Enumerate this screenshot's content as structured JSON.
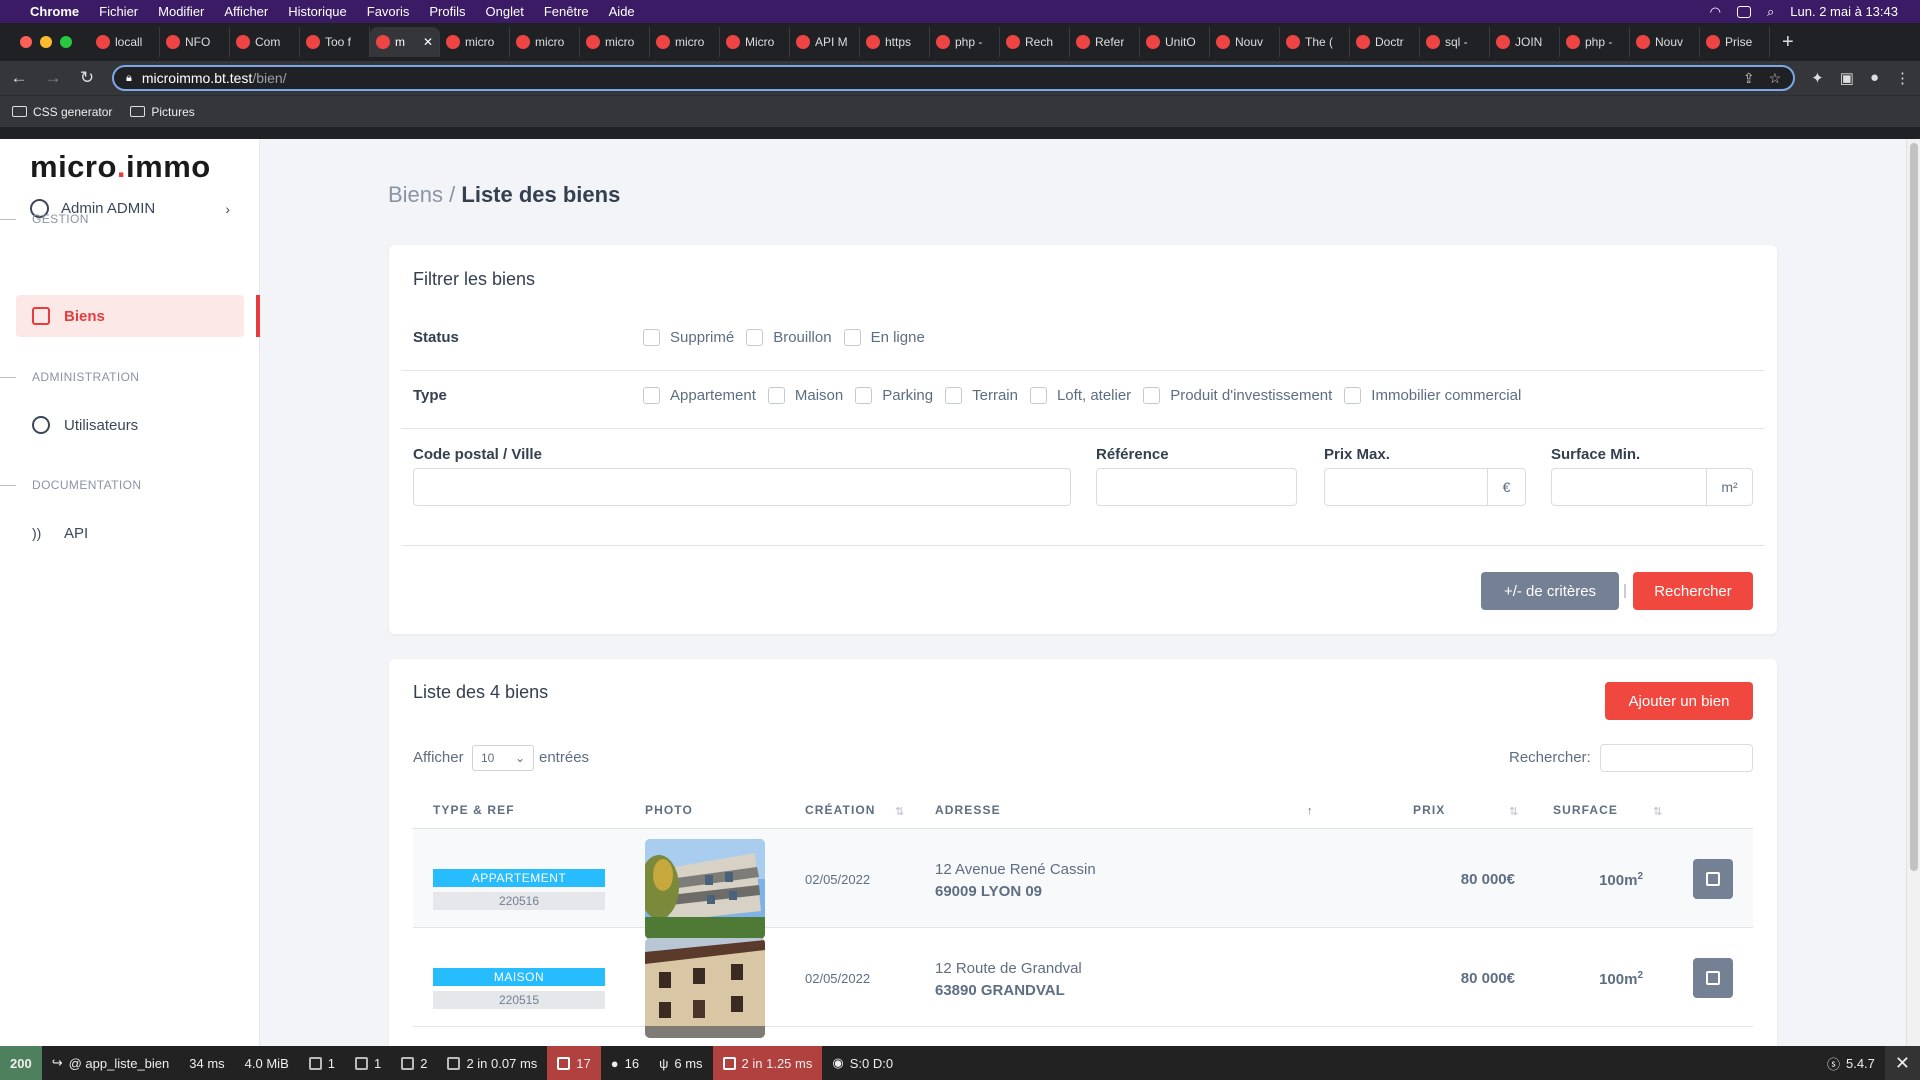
{
  "mac_menu": {
    "app": "Chrome",
    "items": [
      "Fichier",
      "Modifier",
      "Afficher",
      "Historique",
      "Favoris",
      "Profils",
      "Onglet",
      "Fenêtre",
      "Aide"
    ],
    "clock": "Lun. 2 mai à  13:43"
  },
  "tabs": [
    "locall",
    "NFO",
    "Com",
    "Too f",
    "m",
    "micro",
    "micro",
    "micro",
    "micro",
    "Micro",
    "API M",
    "https",
    "php -",
    "Rech",
    "Refer",
    "UnitO",
    "Nouv",
    "The (",
    "Doctr",
    "sql -",
    "JOIN",
    "php -",
    "Nouv",
    "Prise"
  ],
  "active_tab_index": 4,
  "url": {
    "host": "microimmo.bt.test",
    "path": "/bien/"
  },
  "bookmarks": [
    "CSS generator",
    "Pictures"
  ],
  "sidebar": {
    "logo_a": "micro",
    "logo_dot": ".",
    "logo_b": "immo",
    "user": "Admin ADMIN",
    "sections": [
      "GESTION",
      "ADMINISTRATION",
      "DOCUMENTATION"
    ],
    "items": [
      "Biens",
      "Utilisateurs",
      "API"
    ]
  },
  "breadcrumb": {
    "parent": "Biens",
    "separator": " / ",
    "current": "Liste des biens"
  },
  "filter": {
    "title": "Filtrer les biens",
    "status_label": "Status",
    "status_options": [
      "Supprimé",
      "Brouillon",
      "En ligne"
    ],
    "type_label": "Type",
    "type_options": [
      "Appartement",
      "Maison",
      "Parking",
      "Terrain",
      "Loft, atelier",
      "Produit d'investissement",
      "Immobilier commercial"
    ],
    "postal_label": "Code postal / Ville",
    "ref_label": "Référence",
    "price_label": "Prix Max.",
    "price_unit": "€",
    "surface_label": "Surface Min.",
    "surface_unit": "m²",
    "more_button": "+/- de critères",
    "search_button": "Rechercher"
  },
  "list": {
    "title": "Liste des 4 biens",
    "add_button": "Ajouter un bien",
    "show_label": "Afficher",
    "page_size": "10",
    "entries_label": "entrées",
    "search_label": "Rechercher:",
    "columns": [
      "TYPE & REF",
      "PHOTO",
      "CRÉATION",
      "ADRESSE",
      "PRIX",
      "SURFACE"
    ],
    "rows": [
      {
        "type": "APPARTEMENT",
        "ref": "220516",
        "date": "02/05/2022",
        "street": "12 Avenue René Cassin",
        "city": "69009 LYON 09",
        "price": "80 000€",
        "surface": "100m",
        "sup": "2"
      },
      {
        "type": "MAISON",
        "ref": "220515",
        "date": "02/05/2022",
        "street": "12 Route de Grandval",
        "city": "63890 GRANDVAL",
        "price": "80 000€",
        "surface": "100m",
        "sup": "2"
      }
    ]
  },
  "debug_toolbar": {
    "status": "200",
    "route": "@ app_liste_bien",
    "time": "34 ms",
    "memory": "4.0 MiB",
    "forms": "1",
    "logs": "1",
    "cache": "2",
    "events": "2 in 0.07 ms",
    "translations": "17",
    "security": "16",
    "twig": "6 ms",
    "db": "2 in 1.25 ms",
    "server": "S:0 D:0",
    "version": "5.4.7"
  },
  "colors": {
    "accent": "#e53d3d",
    "button_red": "#f0483e",
    "badge_blue": "#27bcfd",
    "button_gray": "#748194"
  }
}
